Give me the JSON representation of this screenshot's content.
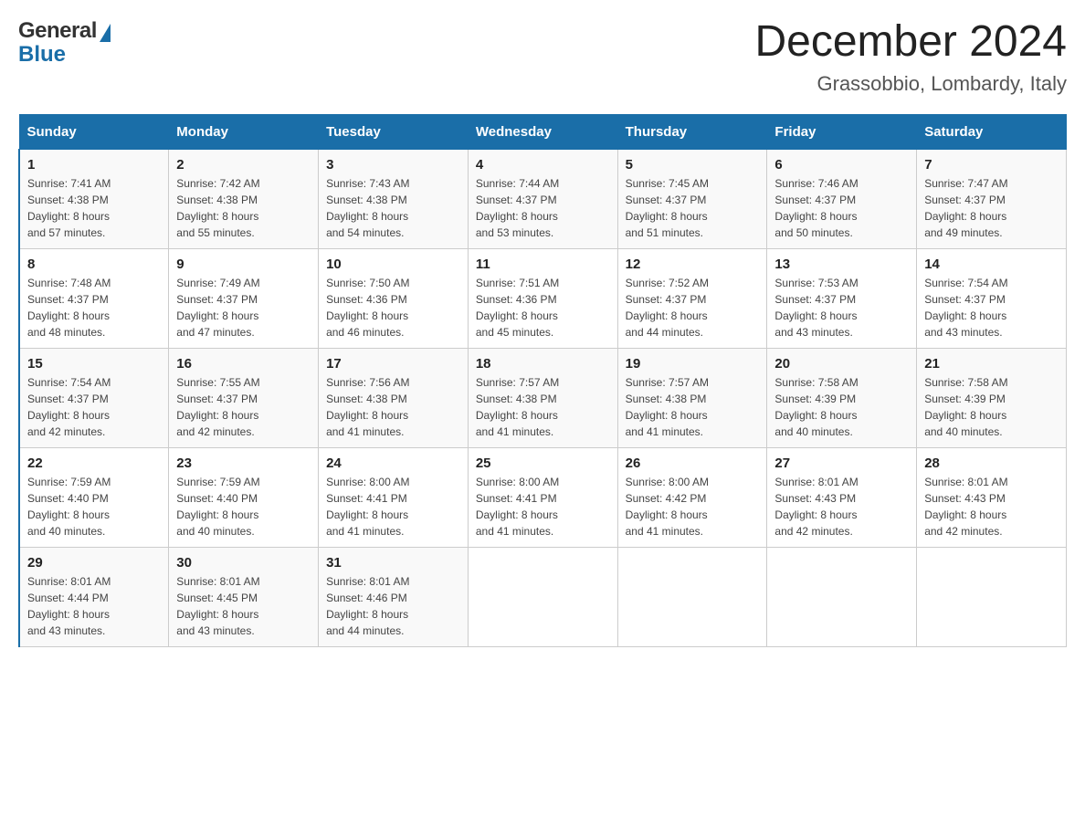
{
  "header": {
    "logo": {
      "general": "General",
      "blue": "Blue"
    },
    "title": "December 2024",
    "location": "Grassobbio, Lombardy, Italy"
  },
  "days_of_week": [
    "Sunday",
    "Monday",
    "Tuesday",
    "Wednesday",
    "Thursday",
    "Friday",
    "Saturday"
  ],
  "weeks": [
    [
      {
        "day": "1",
        "sunrise": "7:41 AM",
        "sunset": "4:38 PM",
        "daylight": "8 hours and 57 minutes."
      },
      {
        "day": "2",
        "sunrise": "7:42 AM",
        "sunset": "4:38 PM",
        "daylight": "8 hours and 55 minutes."
      },
      {
        "day": "3",
        "sunrise": "7:43 AM",
        "sunset": "4:38 PM",
        "daylight": "8 hours and 54 minutes."
      },
      {
        "day": "4",
        "sunrise": "7:44 AM",
        "sunset": "4:37 PM",
        "daylight": "8 hours and 53 minutes."
      },
      {
        "day": "5",
        "sunrise": "7:45 AM",
        "sunset": "4:37 PM",
        "daylight": "8 hours and 51 minutes."
      },
      {
        "day": "6",
        "sunrise": "7:46 AM",
        "sunset": "4:37 PM",
        "daylight": "8 hours and 50 minutes."
      },
      {
        "day": "7",
        "sunrise": "7:47 AM",
        "sunset": "4:37 PM",
        "daylight": "8 hours and 49 minutes."
      }
    ],
    [
      {
        "day": "8",
        "sunrise": "7:48 AM",
        "sunset": "4:37 PM",
        "daylight": "8 hours and 48 minutes."
      },
      {
        "day": "9",
        "sunrise": "7:49 AM",
        "sunset": "4:37 PM",
        "daylight": "8 hours and 47 minutes."
      },
      {
        "day": "10",
        "sunrise": "7:50 AM",
        "sunset": "4:36 PM",
        "daylight": "8 hours and 46 minutes."
      },
      {
        "day": "11",
        "sunrise": "7:51 AM",
        "sunset": "4:36 PM",
        "daylight": "8 hours and 45 minutes."
      },
      {
        "day": "12",
        "sunrise": "7:52 AM",
        "sunset": "4:37 PM",
        "daylight": "8 hours and 44 minutes."
      },
      {
        "day": "13",
        "sunrise": "7:53 AM",
        "sunset": "4:37 PM",
        "daylight": "8 hours and 43 minutes."
      },
      {
        "day": "14",
        "sunrise": "7:54 AM",
        "sunset": "4:37 PM",
        "daylight": "8 hours and 43 minutes."
      }
    ],
    [
      {
        "day": "15",
        "sunrise": "7:54 AM",
        "sunset": "4:37 PM",
        "daylight": "8 hours and 42 minutes."
      },
      {
        "day": "16",
        "sunrise": "7:55 AM",
        "sunset": "4:37 PM",
        "daylight": "8 hours and 42 minutes."
      },
      {
        "day": "17",
        "sunrise": "7:56 AM",
        "sunset": "4:38 PM",
        "daylight": "8 hours and 41 minutes."
      },
      {
        "day": "18",
        "sunrise": "7:57 AM",
        "sunset": "4:38 PM",
        "daylight": "8 hours and 41 minutes."
      },
      {
        "day": "19",
        "sunrise": "7:57 AM",
        "sunset": "4:38 PM",
        "daylight": "8 hours and 41 minutes."
      },
      {
        "day": "20",
        "sunrise": "7:58 AM",
        "sunset": "4:39 PM",
        "daylight": "8 hours and 40 minutes."
      },
      {
        "day": "21",
        "sunrise": "7:58 AM",
        "sunset": "4:39 PM",
        "daylight": "8 hours and 40 minutes."
      }
    ],
    [
      {
        "day": "22",
        "sunrise": "7:59 AM",
        "sunset": "4:40 PM",
        "daylight": "8 hours and 40 minutes."
      },
      {
        "day": "23",
        "sunrise": "7:59 AM",
        "sunset": "4:40 PM",
        "daylight": "8 hours and 40 minutes."
      },
      {
        "day": "24",
        "sunrise": "8:00 AM",
        "sunset": "4:41 PM",
        "daylight": "8 hours and 41 minutes."
      },
      {
        "day": "25",
        "sunrise": "8:00 AM",
        "sunset": "4:41 PM",
        "daylight": "8 hours and 41 minutes."
      },
      {
        "day": "26",
        "sunrise": "8:00 AM",
        "sunset": "4:42 PM",
        "daylight": "8 hours and 41 minutes."
      },
      {
        "day": "27",
        "sunrise": "8:01 AM",
        "sunset": "4:43 PM",
        "daylight": "8 hours and 42 minutes."
      },
      {
        "day": "28",
        "sunrise": "8:01 AM",
        "sunset": "4:43 PM",
        "daylight": "8 hours and 42 minutes."
      }
    ],
    [
      {
        "day": "29",
        "sunrise": "8:01 AM",
        "sunset": "4:44 PM",
        "daylight": "8 hours and 43 minutes."
      },
      {
        "day": "30",
        "sunrise": "8:01 AM",
        "sunset": "4:45 PM",
        "daylight": "8 hours and 43 minutes."
      },
      {
        "day": "31",
        "sunrise": "8:01 AM",
        "sunset": "4:46 PM",
        "daylight": "8 hours and 44 minutes."
      },
      null,
      null,
      null,
      null
    ]
  ],
  "labels": {
    "sunrise": "Sunrise:",
    "sunset": "Sunset:",
    "daylight": "Daylight:"
  }
}
